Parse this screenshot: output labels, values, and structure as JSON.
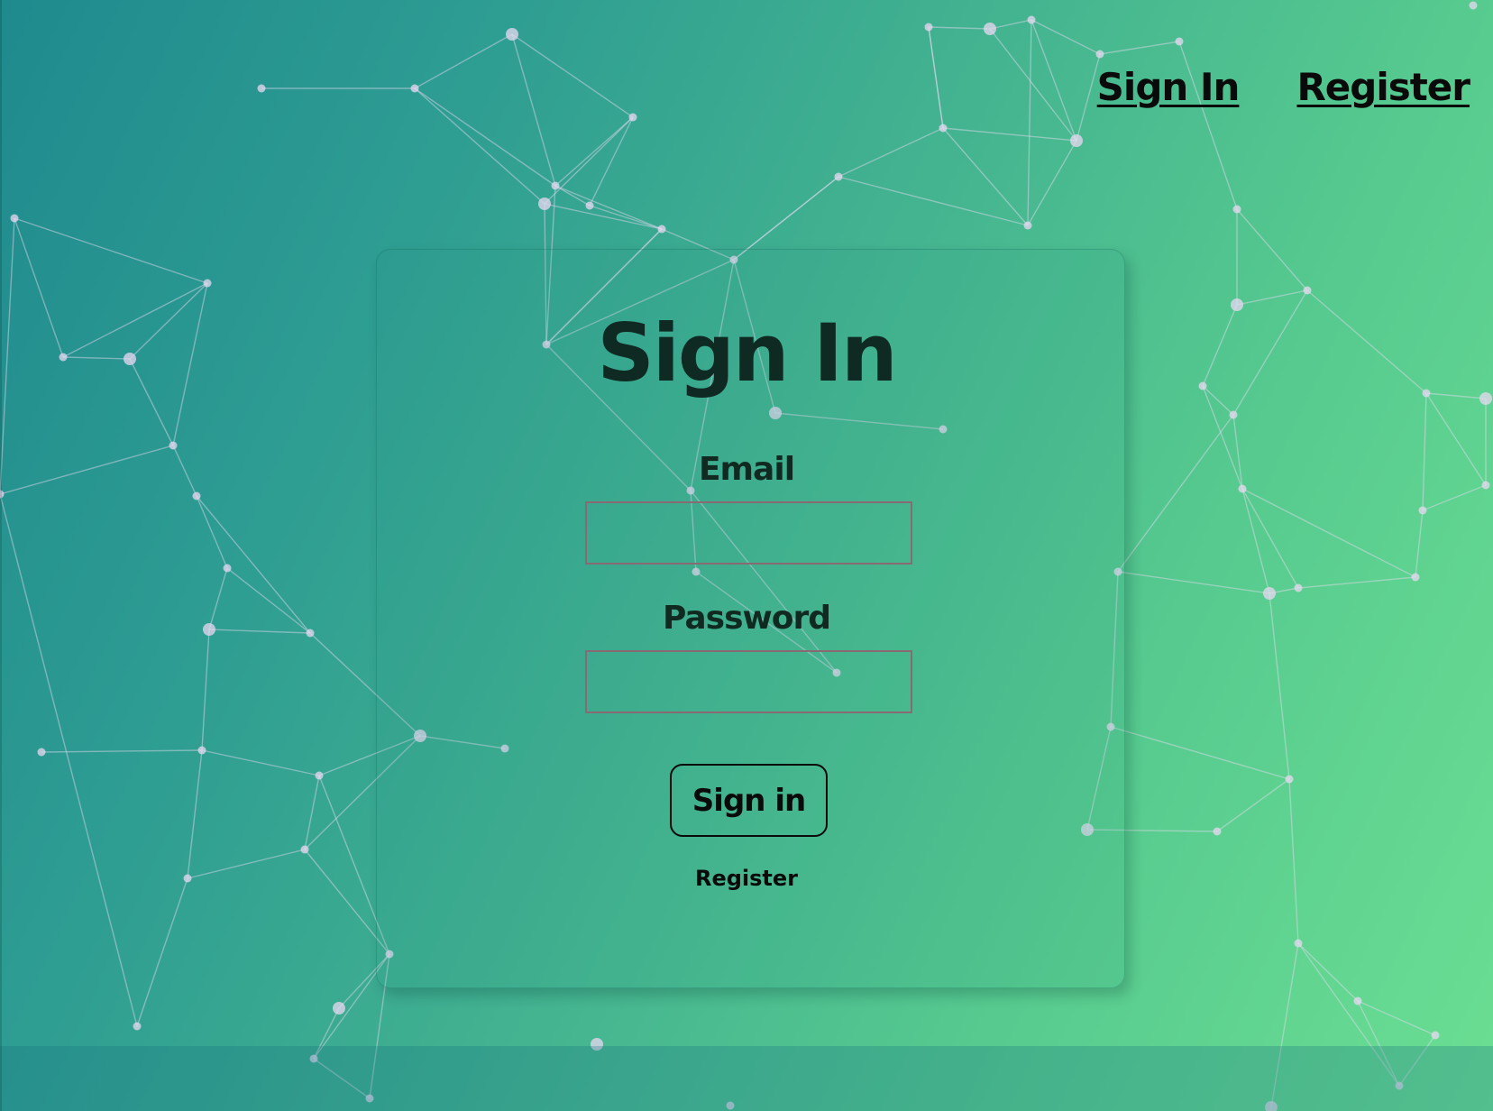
{
  "nav": {
    "sign_in_label": "Sign In",
    "register_label": "Register"
  },
  "form": {
    "title": "Sign In",
    "email_label": "Email",
    "email_value": "",
    "password_label": "Password",
    "password_value": "",
    "submit_label": "Sign in",
    "register_link_label": "Register"
  },
  "theme": {
    "gradient_start": "#1f8a8e",
    "gradient_end": "#6bde93",
    "network_color": "#e6dcf2",
    "field_border": "#8a6a72",
    "text_color": "#0a0a0a"
  }
}
